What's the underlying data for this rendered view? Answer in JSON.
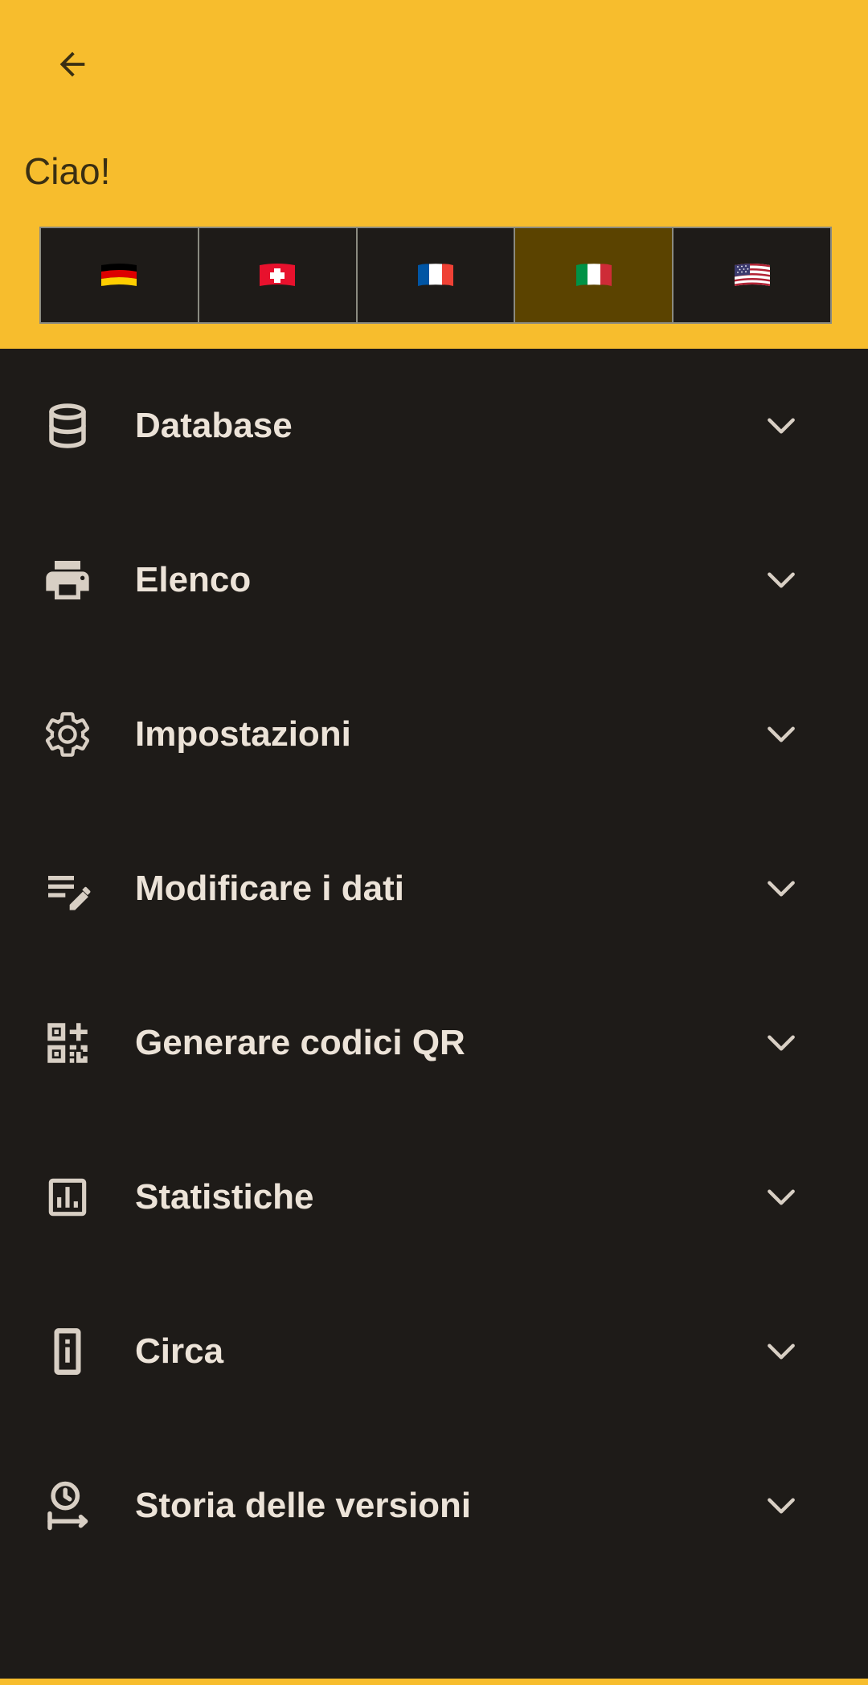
{
  "header": {
    "greeting": "Ciao!",
    "background_color": "#f7bd2d",
    "back_icon": "arrow-left-icon"
  },
  "languages": [
    {
      "name": "german-flag-icon",
      "selected": false
    },
    {
      "name": "swiss-flag-icon",
      "selected": false
    },
    {
      "name": "french-flag-icon",
      "selected": false
    },
    {
      "name": "italian-flag-icon",
      "selected": true
    },
    {
      "name": "us-flag-icon",
      "selected": false
    }
  ],
  "menu": {
    "items": [
      {
        "label": "Database",
        "icon": "database-icon"
      },
      {
        "label": "Elenco",
        "icon": "printer-icon"
      },
      {
        "label": "Impostazioni",
        "icon": "gear-icon"
      },
      {
        "label": "Modificare i dati",
        "icon": "edit-note-icon"
      },
      {
        "label": "Generare codici QR",
        "icon": "qr-code-icon"
      },
      {
        "label": "Statistiche",
        "icon": "bar-chart-icon"
      },
      {
        "label": "Circa",
        "icon": "info-icon"
      },
      {
        "label": "Storia delle versioni",
        "icon": "history-timeline-icon"
      }
    ]
  },
  "colors": {
    "accent": "#f7bd2d",
    "background": "#1e1b18",
    "text": "#ece3d8",
    "selected_language": "#5b4300"
  }
}
